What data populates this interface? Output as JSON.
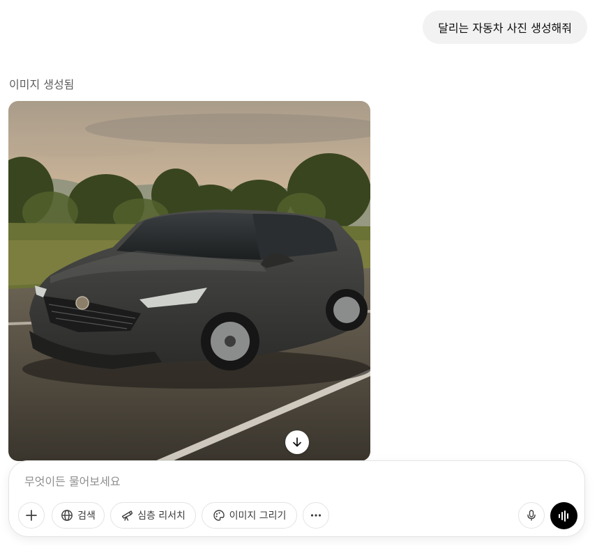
{
  "conversation": {
    "user_message": "달리는 자동차 사진 생성해줘",
    "assistant_status": "이미지 생성됨"
  },
  "generated_image": {
    "subject": "dark gray sedan driving on a road at sunset",
    "download_icon": "arrow-down-icon"
  },
  "composer": {
    "placeholder": "무엇이든 물어보세요",
    "value": "",
    "tools": {
      "add": {
        "icon": "plus-icon"
      },
      "search": {
        "label": "검색",
        "icon": "globe-icon"
      },
      "deep_research": {
        "label": "심층 리서치",
        "icon": "telescope-icon"
      },
      "image": {
        "label": "이미지 그리기",
        "icon": "palette-icon"
      },
      "more": {
        "icon": "ellipsis-icon"
      },
      "mic": {
        "icon": "microphone-icon"
      },
      "voice": {
        "icon": "voice-waveform-icon"
      }
    }
  },
  "colors": {
    "user_bubble_bg": "#f2f2f2",
    "status_text": "#5d5d5d",
    "voice_button_bg": "#000000",
    "composer_border": "#e3e3e3"
  }
}
